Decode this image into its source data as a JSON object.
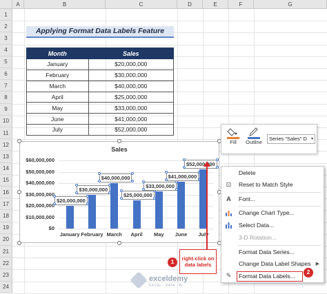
{
  "columns": [
    "A",
    "B",
    "C",
    "D",
    "E",
    "F",
    "G"
  ],
  "rows": [
    "1",
    "2",
    "3",
    "4",
    "5",
    "6",
    "7",
    "8",
    "9",
    "10",
    "11",
    "12",
    "13",
    "14",
    "15",
    "16",
    "17",
    "18",
    "19",
    "20",
    "21",
    "22",
    "23",
    "24"
  ],
  "title": "Applying Format Data Labels Feature",
  "table": {
    "headers": [
      "Month",
      "Sales"
    ],
    "rows": [
      [
        "January",
        "$20,000,000"
      ],
      [
        "February",
        "$30,000,000"
      ],
      [
        "March",
        "$40,000,000"
      ],
      [
        "April",
        "$25,000,000"
      ],
      [
        "May",
        "$33,000,000"
      ],
      [
        "June",
        "$41,000,000"
      ],
      [
        "July",
        "$52,000,000"
      ]
    ]
  },
  "chart_data": {
    "type": "bar",
    "title": "Sales",
    "categories": [
      "January",
      "February",
      "March",
      "April",
      "May",
      "June",
      "July"
    ],
    "values": [
      20000000,
      30000000,
      40000000,
      25000000,
      33000000,
      41000000,
      52000000
    ],
    "value_labels": [
      "$20,000,000",
      "$30,000,000",
      "$40,000,000",
      "$25,000,000",
      "$33,000,000",
      "$41,000,000",
      "$52,000,000"
    ],
    "ylim": [
      0,
      60000000
    ],
    "yticks": [
      "$0",
      "$10,000,000",
      "$20,000,000",
      "$30,000,000",
      "$40,000,000",
      "$50,000,000",
      "$60,000,000"
    ],
    "bar_color": "#4472c4",
    "grid": true,
    "xlabel": "",
    "ylabel": ""
  },
  "minibar": {
    "fill_label": "Fill",
    "outline_label": "Outline",
    "series_select": "Series \"Sales\" D"
  },
  "context_menu": {
    "items": [
      "Delete",
      "Reset to Match Style",
      "Font...",
      "Change Chart Type...",
      "Select Data...",
      "3-D Rotation...",
      "Format Data Series...",
      "Change Data Label Shapes",
      "Format Data Labels..."
    ]
  },
  "annotation": {
    "callout": "right-click on data labels",
    "badge1": "1",
    "badge2": "2"
  },
  "watermark": {
    "name": "exceldemy",
    "tagline": "EXCEL · DATA · BI"
  },
  "colors": {
    "accent_red": "#d42a2a",
    "header_navy": "#1f3864",
    "bar_blue": "#4472c4"
  }
}
